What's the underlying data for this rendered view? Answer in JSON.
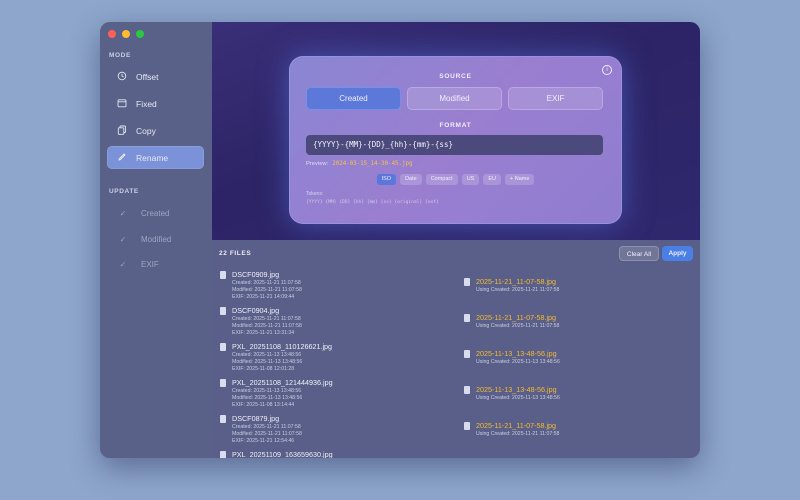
{
  "sidebar": {
    "mode_title": "MODE",
    "modes": [
      {
        "label": "Offset",
        "icon": "clock-history-icon"
      },
      {
        "label": "Fixed",
        "icon": "calendar-icon"
      },
      {
        "label": "Copy",
        "icon": "copy-icon"
      },
      {
        "label": "Rename",
        "icon": "pencil-icon",
        "active": true
      }
    ],
    "update_title": "UPDATE",
    "updates": [
      {
        "label": "Created",
        "checked": true
      },
      {
        "label": "Modified",
        "checked": true
      },
      {
        "label": "EXIF",
        "checked": true
      }
    ]
  },
  "card": {
    "source_title": "SOURCE",
    "sources": [
      "Created",
      "Modified",
      "EXIF"
    ],
    "active_source": "Created",
    "format_title": "FORMAT",
    "format_value": "{YYYY}-{MM}-{DD}_{hh}-{mm}-{ss}",
    "preview_label": "Preview:",
    "preview_value": "2024-03-15_14-30-45.jpg",
    "presets": [
      "ISO",
      "Date",
      "Compact",
      "US",
      "EU",
      "+ Name"
    ],
    "active_preset": "ISO",
    "tokens_label": "Tokens:",
    "tokens_value": "{YYYY} {MM} {DD} {hh} {mm} {ss} {original} {ext}"
  },
  "files": {
    "title": "22 FILES",
    "clear_label": "Clear All",
    "apply_label": "Apply",
    "items": [
      {
        "name": "DSCF0909.jpg",
        "created": "Created: 2025-11-21 11:07:58",
        "modified": "Modified: 2025-11-21 11:07:58",
        "exif": "EXIF: 2025-11-21 14:09:44",
        "new_name": "2025-11-21_11-07-58.jpg",
        "using": "Using Created: 2025-11-21 11:07:58"
      },
      {
        "name": "DSCF0904.jpg",
        "created": "Created: 2025-11-21 11:07:58",
        "modified": "Modified: 2025-11-21 11:07:58",
        "exif": "EXIF: 2025-11-21 13:31:34",
        "new_name": "2025-11-21_11-07-58.jpg",
        "using": "Using Created: 2025-11-21 11:07:58"
      },
      {
        "name": "PXL_20251108_110126621.jpg",
        "created": "Created: 2025-11-13 13:48:56",
        "modified": "Modified: 2025-11-13 13:48:56",
        "exif": "EXIF: 2025-11-08 12:01:28",
        "new_name": "2025-11-13_13-48-56.jpg",
        "using": "Using Created: 2025-11-13 13:48:56"
      },
      {
        "name": "PXL_20251108_121444936.jpg",
        "created": "Created: 2025-11-13 13:48:56",
        "modified": "Modified: 2025-11-13 13:48:56",
        "exif": "EXIF: 2025-11-08 13:14:44",
        "new_name": "2025-11-13_13-48-56.jpg",
        "using": "Using Created: 2025-11-13 13:48:56"
      },
      {
        "name": "DSCF0879.jpg",
        "created": "Created: 2025-11-21 11:07:58",
        "modified": "Modified: 2025-11-21 11:07:58",
        "exif": "EXIF: 2025-11-21 12:54:46",
        "new_name": "2025-11-21_11-07-58.jpg",
        "using": "Using Created: 2025-11-21 11:07:58"
      },
      {
        "name": "PXL_20251109_163659630.jpg",
        "created": "",
        "modified": "",
        "exif": "",
        "new_name": "",
        "using": ""
      }
    ]
  }
}
